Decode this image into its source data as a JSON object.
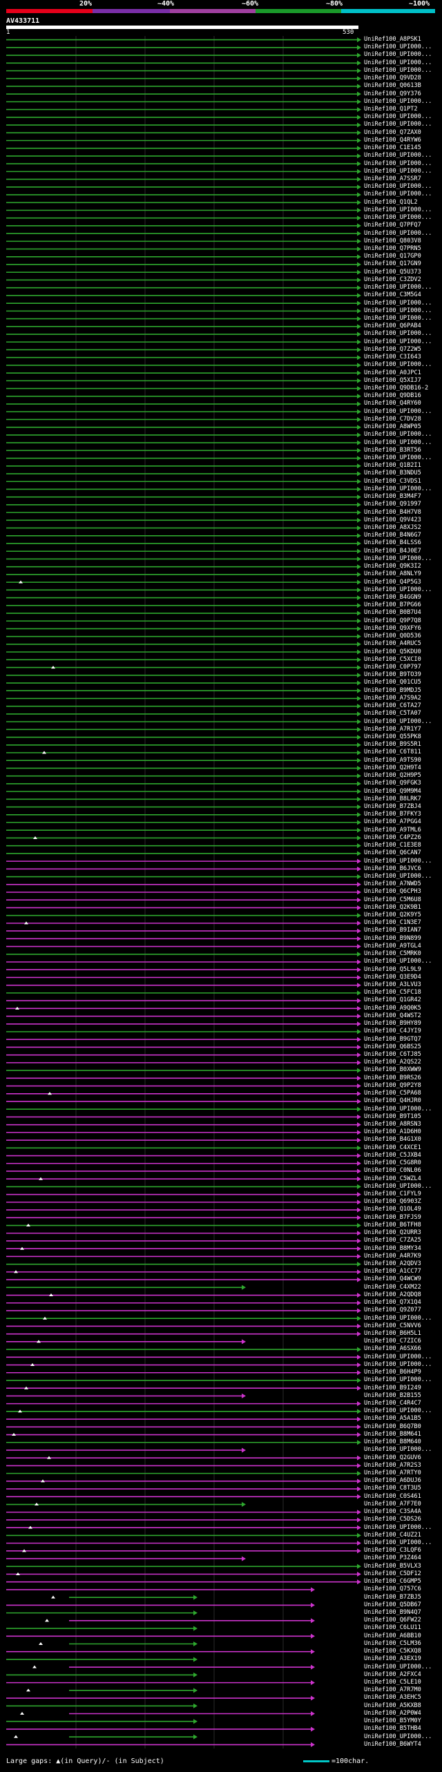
{
  "scale": {
    "labels": [
      "20%",
      "~40%",
      "~60%",
      "~80%",
      "~100%"
    ],
    "colors": [
      "#e6001a",
      "#7a2ea8",
      "#a040a0",
      "#1a9a2a",
      "#00c0c8"
    ]
  },
  "query": {
    "name": "AV433711",
    "start": "1",
    "end": "530"
  },
  "colors": {
    "green": "#2ea82e",
    "magenta": "#cc33cc",
    "cyan": "#20c8d8",
    "white": "#ffffff"
  },
  "hits": [
    "UniRef100_A8PSK1",
    "UniRef100_UPI000...",
    "UniRef100_UPI000...",
    "UniRef100_UPI000...",
    "UniRef100_UPI000...",
    "UniRef100_Q9VD28",
    "UniRef100_Q0613B",
    "UniRef100_Q9Y376",
    "UniRef100_UPI000...",
    "UniRef100_Q1PT2",
    "UniRef100_UPI000...",
    "UniRef100_UPI000...",
    "UniRef100_Q7ZAX0",
    "UniRef100_Q4RYW6",
    "UniRef100_C1E145",
    "UniRef100_UPI000...",
    "UniRef100_UPI000...",
    "UniRef100_UPI000...",
    "UniRef100_A7SSR7",
    "UniRef100_UPI000...",
    "UniRef100_UPI000...",
    "UniRef100_Q1QL2",
    "UniRef100_UPI000...",
    "UniRef100_UPI000...",
    "UniRef100_Q7PFQ7",
    "UniRef100_UPI000...",
    "UniRef100_Q803V8",
    "UniRef100_Q7PRN5",
    "UniRef100_Q17GP0",
    "UniRef100_Q17GN9",
    "UniRef100_Q5U373",
    "UniRef100_C3ZDV2",
    "UniRef100_UPI000...",
    "UniRef100_C3M5G4",
    "UniRef100_UPI000...",
    "UniRef100_UPI000...",
    "UniRef100_UPI000...",
    "UniRef100_Q6PAB4",
    "UniRef100_UPI000...",
    "UniRef100_UPI000...",
    "UniRef100_Q7Z2W5",
    "UniRef100_C3I643",
    "UniRef100_UPI000...",
    "UniRef100_A0JPC1",
    "UniRef100_Q5XIJ7",
    "UniRef100_Q9DB16-2",
    "UniRef100_Q9DB16",
    "UniRef100_Q4RY60",
    "UniRef100_UPI000...",
    "UniRef100_C7DV28",
    "UniRef100_A8WP05",
    "UniRef100_UPI000...",
    "UniRef100_UPI000...",
    "UniRef100_B3RT56",
    "UniRef100_UPI000...",
    "UniRef100_Q1B2I1",
    "UniRef100_B3NDU5",
    "UniRef100_C3VDS1",
    "UniRef100_UPI000...",
    "UniRef100_B3M4F7",
    "UniRef100_Q91997",
    "UniRef100_B4H7V8",
    "UniRef100_Q9V423",
    "UniRef100_A8XJS2",
    "UniRef100_B4N6G7",
    "UniRef100_B4LSS6",
    "UniRef100_B4J0E7",
    "UniRef100_UPI000...",
    "UniRef100_Q9K3I2",
    "UniRef100_A8NLY9",
    "UniRef100_Q4P5G3",
    "UniRef100_UPI000...",
    "UniRef100_B4GGN9",
    "UniRef100_B7PG66",
    "UniRef100_B0B7U4",
    "UniRef100_Q9P7Q8",
    "UniRef100_Q9XFY6",
    "UniRef100_Q0D536",
    "UniRef100_A4RUC5",
    "UniRef100_Q5KDU0",
    "UniRef100_C5XCI0",
    "UniRef100_C0P797",
    "UniRef100_B9TO39",
    "UniRef100_Q01CU5",
    "UniRef100_B9MDJ5",
    "UniRef100_A7S9A2",
    "UniRef100_C6TA27",
    "UniRef100_C5TA07",
    "UniRef100_UPI000...",
    "UniRef100_A7R1Y7",
    "UniRef100_Q55PK8",
    "UniRef100_B9S5R1",
    "UniRef100_C6T811",
    "UniRef100_A9TS90",
    "UniRef100_Q2H9T4",
    "UniRef100_Q2H9P5",
    "UniRef100_Q9FGK3",
    "UniRef100_Q9M9M4",
    "UniRef100_B8LRK7",
    "UniRef100_B7ZBJ4",
    "UniRef100_B7FKY3",
    "UniRef100_A7PGG4",
    "UniRef100_A9TML6",
    "UniRef100_C4PZ26",
    "UniRef100_C1E3E8",
    "UniRef100_Q6CAN7",
    "UniRef100_UPI000...",
    "UniRef100_B6JVC6",
    "UniRef100_UPI000...",
    "UniRef100_A7NWD5",
    "UniRef100_Q6CPH3",
    "UniRef100_C5M6U8",
    "UniRef100_Q2K9B1",
    "UniRef100_Q2K9Y5",
    "UniRef100_C1N3E7",
    "UniRef100_B9IAN7",
    "UniRef100_B9N899",
    "UniRef100_A9TGL4",
    "UniRef100_C5MRK0",
    "UniRef100_UPI000...",
    "UniRef100_Q5L9L9",
    "UniRef100_Q3E9D4",
    "UniRef100_A3LVU3",
    "UniRef100_C5FC18",
    "UniRef100_Q1GR42",
    "UniRef100_A9Q0K5",
    "UniRef100_Q4WST2",
    "UniRef100_B9HY89",
    "UniRef100_C4JYI9",
    "UniRef100_B9GTQ7",
    "UniRef100_Q6BS25",
    "UniRef100_C6TJ85",
    "UniRef100_A2QS22",
    "UniRef100_B0XWW9",
    "UniRef100_B9RS26",
    "UniRef100_Q9P2Y8",
    "UniRef100_C5PA68",
    "UniRef100_Q4HJR0",
    "UniRef100_UPI000...",
    "UniRef100_B9T105",
    "UniRef100_A8RSN3",
    "UniRef100_A1D6H0",
    "UniRef100_B4G1X0",
    "UniRef100_C4XCE1",
    "UniRef100_C5JXB4",
    "UniRef100_C5G8R0",
    "UniRef100_C0NL06",
    "UniRef100_C5WZL4",
    "UniRef100_UPI000...",
    "UniRef100_C1FYL9",
    "UniRef100_Q6903Z",
    "UniRef100_Q1OL49",
    "UniRef100_B7FJS9",
    "UniRef100_B6TFH8",
    "UniRef100_Q2URR3",
    "UniRef100_C7ZA25",
    "UniRef100_B8MY34",
    "UniRef100_A4R7K9",
    "UniRef100_A2QDV3",
    "UniRef100_A1CC77",
    "UniRef100_Q4WCW9",
    "UniRef100_C4XM22",
    "UniRef100_A2QDQ8",
    "UniRef100_Q7X1Q4",
    "UniRef100_Q9Z077",
    "UniRef100_UPI000...",
    "UniRef100_C5NVV6",
    "UniRef100_B6H5L1",
    "UniRef100_C7ZIC6",
    "UniRef100_A6SX66",
    "UniRef100_UPI000...",
    "UniRef100_UPI000...",
    "UniRef100_B6H4P9",
    "UniRef100_UPI000...",
    "UniRef100_B9I249",
    "UniRef100_B2B155",
    "UniRef100_C4R4C7",
    "UniRef100_UPI000...",
    "UniRef100_A5A1B5",
    "UniRef100_B6Q7B0",
    "UniRef100_B8M641",
    "UniRef100_B8M640",
    "UniRef100_UPI000...",
    "UniRef100_Q2GUV6",
    "UniRef100_A7R2S3",
    "UniRef100_A7RTY0",
    "UniRef100_A6DUJ6",
    "UniRef100_C8T3U5",
    "UniRef100_C0S461",
    "UniRef100_A7F7E0",
    "UniRef100_C3SA4A",
    "UniRef100_C5DS26",
    "UniRef100_UPI000...",
    "UniRef100_C4UZ21",
    "UniRef100_UPI000...",
    "UniRef100_C3LQF6",
    "UniRef100_P3Z464",
    "UniRef100_B5VLX3",
    "UniRef100_C5DF12",
    "UniRef100_C6GMP5",
    "UniRef100_Q757C6",
    "UniRef100_B7ZBJ5",
    "UniRef100_Q5DB67",
    "UniRef100_B9N4Q7",
    "UniRef100_Q6FW22",
    "UniRef100_C6LU11",
    "UniRef100_A6BB10",
    "UniRef100_C5LM36",
    "UniRef100_C5KXQ8",
    "UniRef100_A3EX19",
    "UniRef100_UPI000...",
    "UniRef100_A2FXC4",
    "UniRef100_C5LE10",
    "UniRef100_A7R7M0",
    "UniRef100_A3EHC5",
    "UniRef100_A5KXB8",
    "UniRef100_A2P0W4",
    "UniRef100_B5YM0Y",
    "UniRef100_B5THB4",
    "UniRef100_UPI000...",
    "UniRef100_B6WYT4"
  ],
  "footer": {
    "gaps_label": "Large gaps: ▲(in Query)/- (in Subject)",
    "scale_label": "=100char."
  }
}
